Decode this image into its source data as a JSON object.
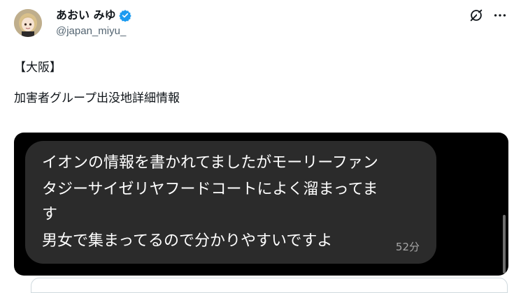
{
  "user": {
    "display_name": "あおい みゆ",
    "handle": "@japan_miyu_",
    "avatar_icon": "avatar-illustration-icon",
    "verified_icon": "verified-badge-icon",
    "verified_color": "#1d9bf0"
  },
  "actions": {
    "grok_icon": "grok-icon",
    "more_icon": "more-options-icon"
  },
  "post": {
    "lines": [
      "【大阪】",
      "",
      "加害者グループ出没地詳細情報"
    ]
  },
  "media": {
    "message_lines": [
      "イオンの情報を書かれてましたがモーリーファン",
      "タジーサイゼリヤフードコートによく溜まってま",
      "す",
      "男女で集まってるので分かりやすいですよ"
    ],
    "timestamp": "52分",
    "bubble_color": "#2b2b2b",
    "background_color": "#000000"
  }
}
